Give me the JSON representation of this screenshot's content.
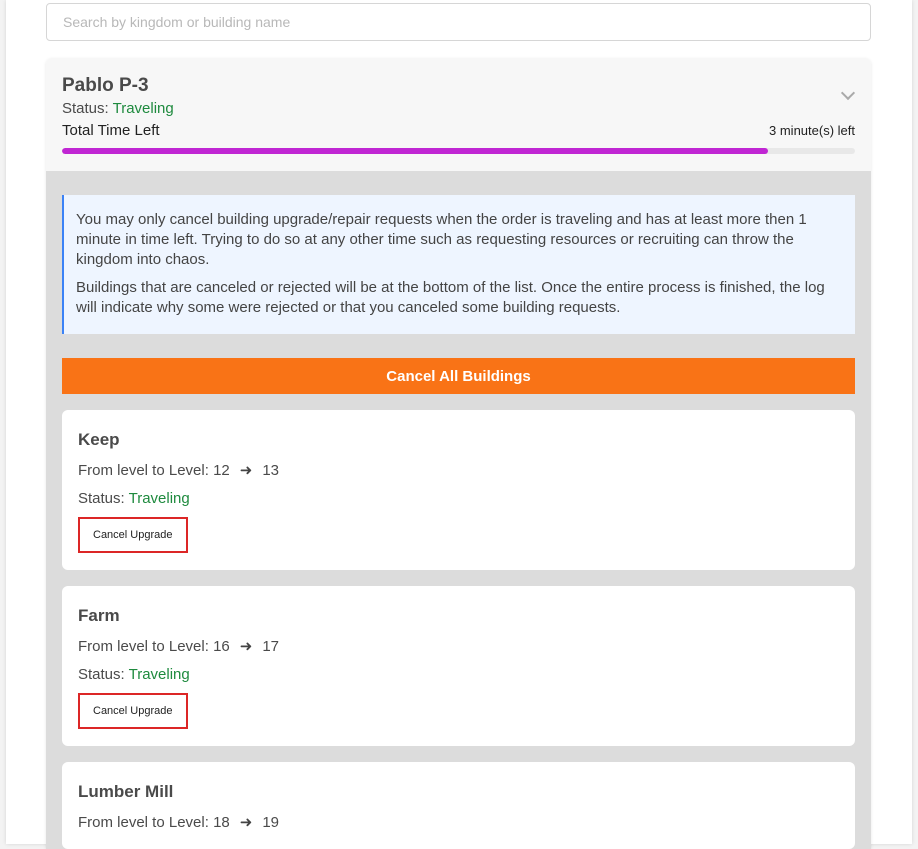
{
  "search": {
    "placeholder": "Search by kingdom or building name",
    "value": ""
  },
  "order": {
    "title": "Pablo P-3",
    "status_label": "Status:",
    "status": "Traveling",
    "time_label": "Total Time Left",
    "time_left": "3 minute(s) left",
    "progress_percent": 89,
    "progress_color": "#c026d3"
  },
  "info": {
    "p1": "You may only cancel building upgrade/repair requests when the order is traveling and has at least more then 1 minute in time left. Trying to do so at any other time such as requesting resources or recruiting can throw the kingdom into chaos.",
    "p2": "Buildings that are canceled or rejected will be at the bottom of the list. Once the entire process is finished, the log will indicate why some were rejected or that you canceled some building requests."
  },
  "cancel_all_label": "Cancel All Buildings",
  "buildings": [
    {
      "name": "Keep",
      "level_label": "From level to Level:",
      "from": "12",
      "to": "13",
      "status_label": "Status:",
      "status": "Traveling",
      "button": "Cancel Upgrade"
    },
    {
      "name": "Farm",
      "level_label": "From level to Level:",
      "from": "16",
      "to": "17",
      "status_label": "Status:",
      "status": "Traveling",
      "button": "Cancel Upgrade"
    },
    {
      "name": "Lumber Mill",
      "level_label": "From level to Level:",
      "from": "18",
      "to": "19"
    }
  ]
}
